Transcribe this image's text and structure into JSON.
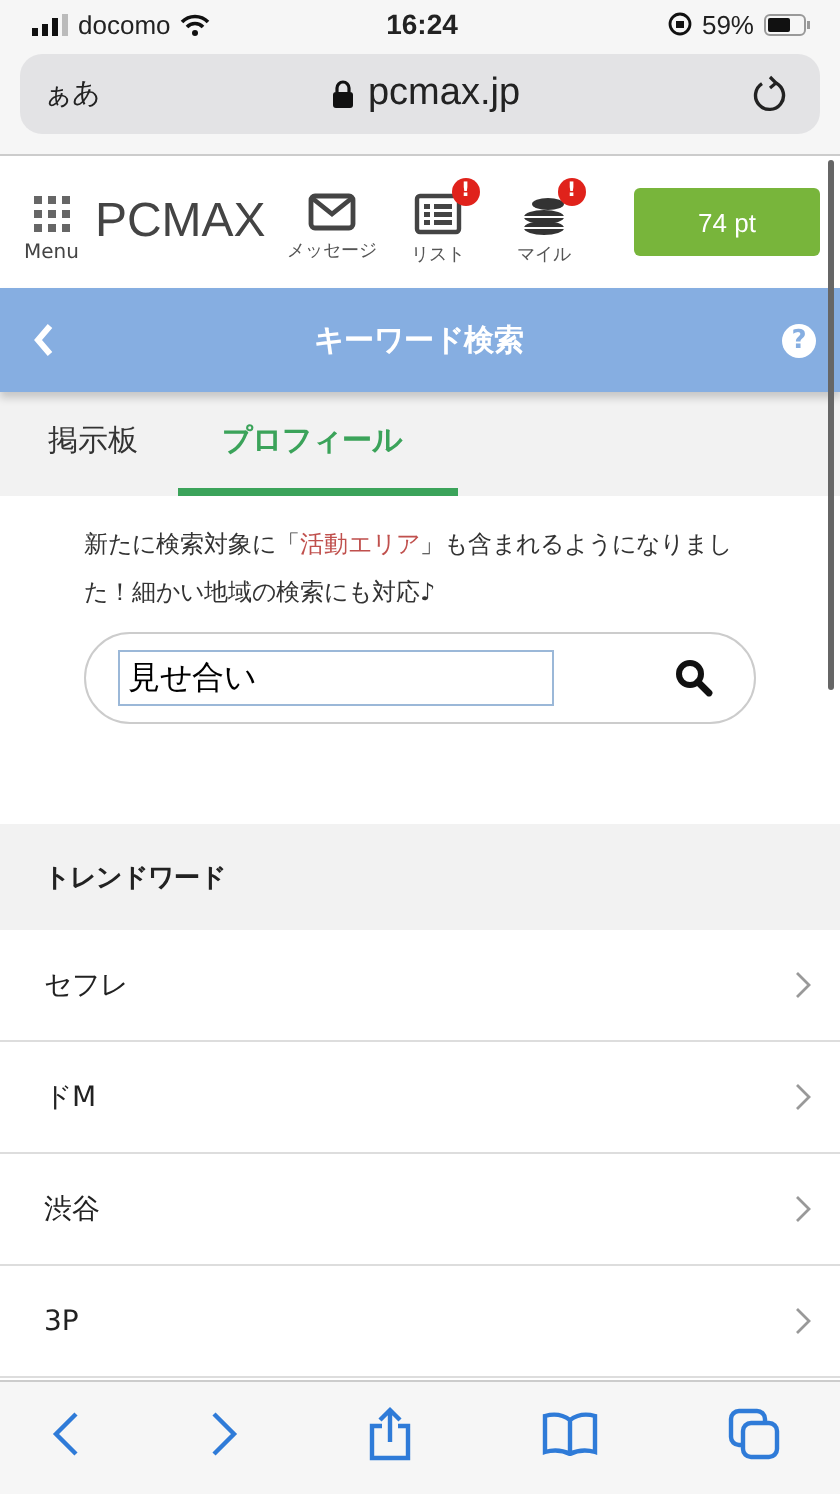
{
  "status_bar": {
    "carrier": "docomo",
    "time": "16:24",
    "battery": "59%"
  },
  "browser": {
    "text_size_button": "ぁあ",
    "url": "pcmax.jp"
  },
  "header": {
    "menu_label": "Menu",
    "logo": "PCMAX",
    "nav": [
      {
        "label": "メッセージ",
        "kind": "mail"
      },
      {
        "label": "リスト",
        "kind": "list",
        "badge": "!"
      },
      {
        "label": "マイル",
        "kind": "coins",
        "badge": "!"
      }
    ],
    "points": "74 pt"
  },
  "title_bar": {
    "title": "キーワード検索",
    "help": "?"
  },
  "tabs": [
    {
      "label": "掲示板",
      "selected": false
    },
    {
      "label": "プロフィール",
      "selected": true
    }
  ],
  "notice": {
    "before": "新たに検索対象に「",
    "highlight": "活動エリア",
    "after": "」も含まれるようになりました！細かい地域の検索にも対応♪"
  },
  "search": {
    "value": "見せ合い"
  },
  "trend": {
    "heading": "トレンドワード",
    "items": [
      "セフレ",
      "ドM",
      "渋谷",
      "3P"
    ]
  }
}
